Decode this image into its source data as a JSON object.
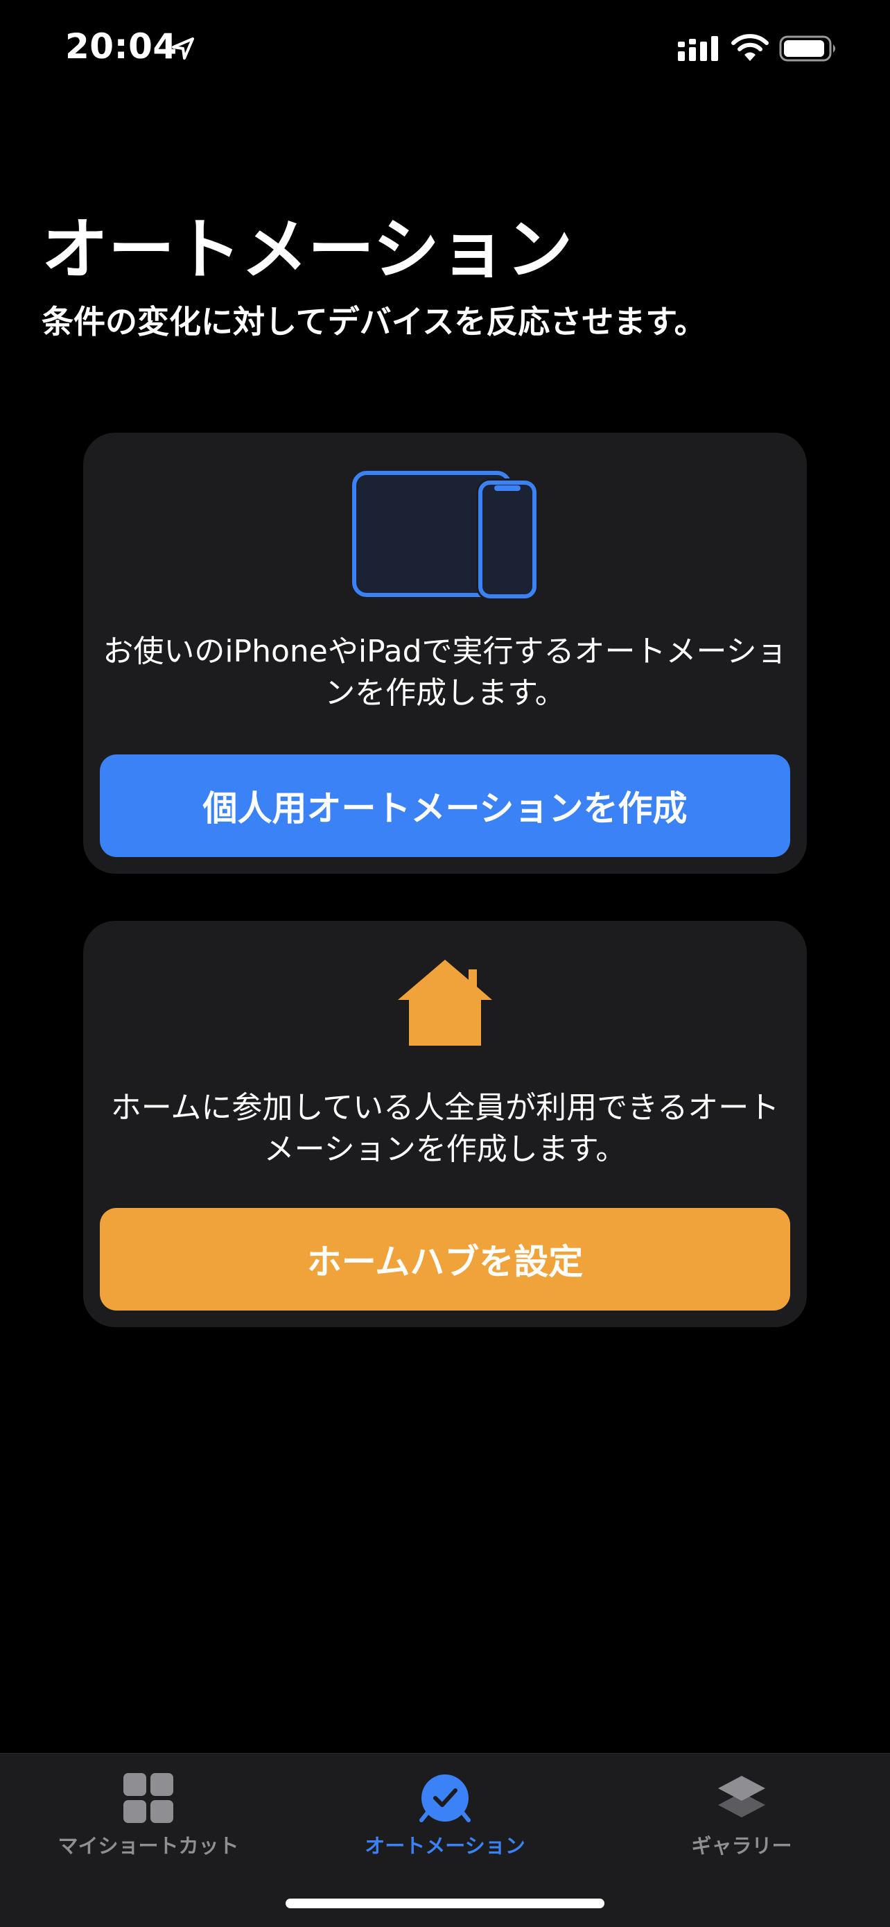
{
  "status_bar": {
    "time": "20:04",
    "icons": [
      "location-arrow-icon",
      "cellular-signal-icon",
      "wifi-icon",
      "battery-icon"
    ]
  },
  "header": {
    "title": "オートメーション",
    "subtitle": "条件の変化に対してデバイスを反応させます。"
  },
  "cards": {
    "personal": {
      "icon": "ipad-iphone-icon",
      "description": "お使いのiPhoneやiPadで実行するオートメーションを作成します。",
      "button_label": "個人用オートメーションを作成"
    },
    "home": {
      "icon": "house-icon",
      "description": "ホームに参加している人全員が利用できるオートメーションを作成します。",
      "button_label": "ホームハブを設定"
    }
  },
  "tab_bar": {
    "tabs": [
      {
        "label": "マイショートカット",
        "icon": "grid-icon",
        "selected": false
      },
      {
        "label": "オートメーション",
        "icon": "clock-check-icon",
        "selected": true
      },
      {
        "label": "ギャラリー",
        "icon": "layers-icon",
        "selected": false
      }
    ]
  },
  "colors": {
    "background": "#000000",
    "card": "#1c1c1e",
    "accent_blue": "#3b82f6",
    "accent_orange": "#f0a33b",
    "tab_inactive": "#8e8e93"
  }
}
